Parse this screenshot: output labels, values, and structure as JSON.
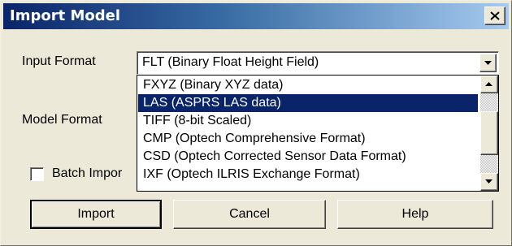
{
  "dialog": {
    "title": "Import Model",
    "close_glyph": "close-icon"
  },
  "fields": {
    "input_format_label": "Input Format",
    "input_format_value": "FLT  (Binary Float Height Field)",
    "model_format_label": "Model Format",
    "batch_import_label": "Batch Impor",
    "batch_import_checked": false
  },
  "dropdown": {
    "items": [
      "FXYZ (Binary XYZ data)",
      "LAS  (ASPRS LAS data)",
      "TIFF (8-bit Scaled)",
      "CMP  (Optech Comprehensive Format)",
      "CSD  (Optech Corrected Sensor Data Format)",
      "IXF  (Optech ILRIS Exchange Format)"
    ],
    "selected_index": 1
  },
  "buttons": {
    "import": "Import",
    "cancel": "Cancel",
    "help": "Help"
  },
  "colors": {
    "title_bar": "#0a246a",
    "selection": "#0a246a",
    "dialog_bg": "#ece9d8"
  }
}
